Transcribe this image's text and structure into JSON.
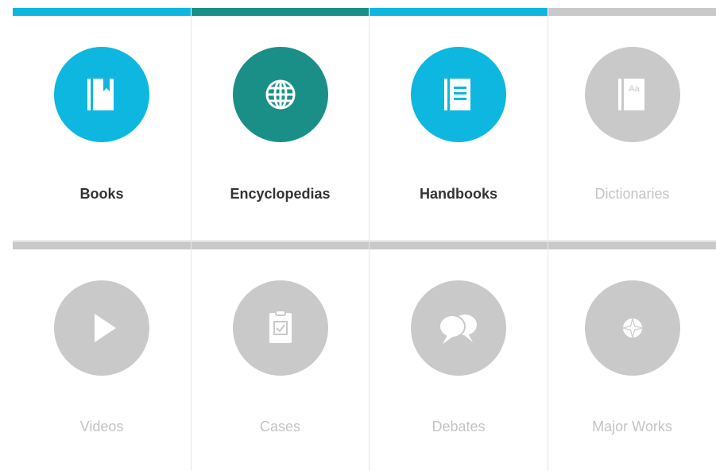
{
  "colors": {
    "cyan": "#0db7e0",
    "teal": "#1a8f87",
    "grey": "#c9c9c9",
    "label_active": "#333333",
    "label_inactive": "#c4c4c4"
  },
  "tiles": [
    {
      "label": "Books",
      "icon": "book-bookmark-icon",
      "state": "active"
    },
    {
      "label": "Encyclopedias",
      "icon": "globe-icon",
      "state": "active"
    },
    {
      "label": "Handbooks",
      "icon": "handbook-icon",
      "state": "active"
    },
    {
      "label": "Dictionaries",
      "icon": "dictionary-icon",
      "state": "inactive"
    },
    {
      "label": "Videos",
      "icon": "play-icon",
      "state": "inactive"
    },
    {
      "label": "Cases",
      "icon": "clipboard-check-icon",
      "state": "inactive"
    },
    {
      "label": "Debates",
      "icon": "speech-bubbles-icon",
      "state": "inactive"
    },
    {
      "label": "Major Works",
      "icon": "compass-icon",
      "state": "inactive"
    }
  ]
}
